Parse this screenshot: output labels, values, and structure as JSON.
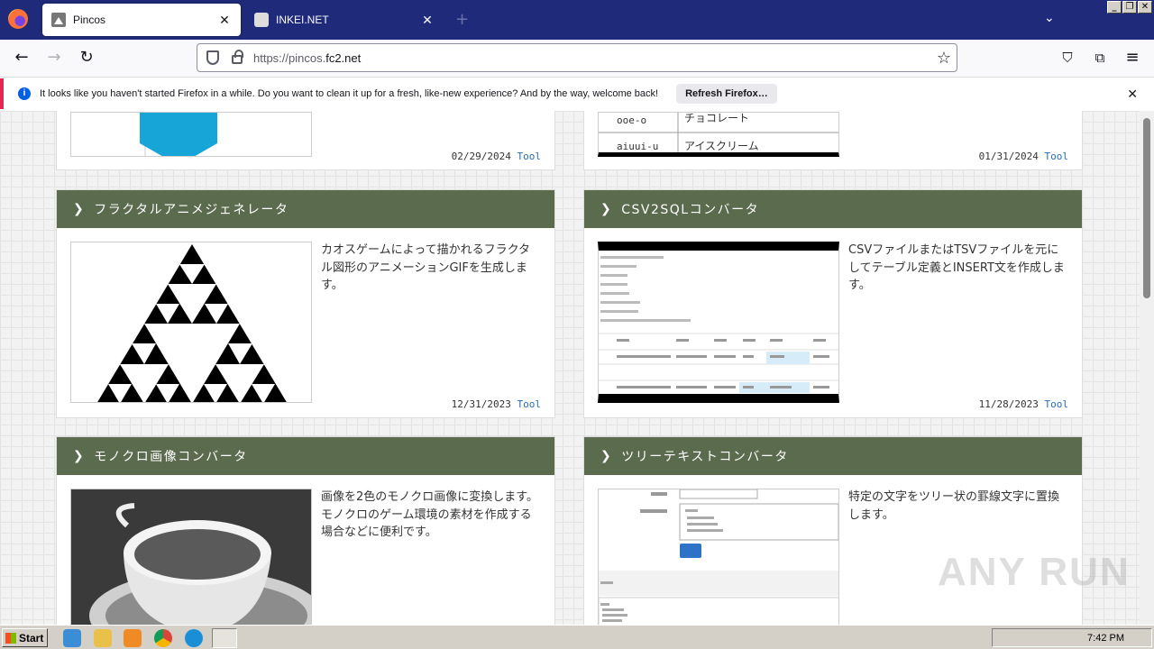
{
  "browser": {
    "tabs": [
      {
        "title": "Pincos",
        "active": true
      },
      {
        "title": "INKEI.NET",
        "active": false
      }
    ],
    "url_prefix": "https://pincos.",
    "url_domain": "fc2.net"
  },
  "notification": {
    "message": "It looks like you haven't started Firefox in a while. Do you want to clean it up for a fresh, like-new experience? And by the way, welcome back!",
    "button": "Refresh Firefox…"
  },
  "cards_top": [
    {
      "date": "02/29/2024",
      "link": "Tool"
    },
    {
      "date": "01/31/2024",
      "link": "Tool",
      "table_rows": [
        [
          "ooe-o",
          "チョコレート"
        ],
        [
          "aiuui-u",
          "アイスクリーム"
        ]
      ]
    }
  ],
  "cards": [
    {
      "title": "フラクタルアニメジェネレータ",
      "desc": "カオスゲームによって描かれるフラクタル図形のアニメーションGIFを生成します。",
      "date": "12/31/2023",
      "link": "Tool"
    },
    {
      "title": "CSV2SQLコンバータ",
      "desc": "CSVファイルまたはTSVファイルを元にしてテーブル定義とINSERT文を作成します。",
      "date": "11/28/2023",
      "link": "Tool"
    },
    {
      "title": "モノクロ画像コンバータ",
      "desc": "画像を2色のモノクロ画像に変換します。\nモノクロのゲーム環境の素材を作成する場合などに便利です。",
      "date": "",
      "link": ""
    },
    {
      "title": "ツリーテキストコンバータ",
      "desc": "特定の文字をツリー状の罫線文字に置換します。",
      "date": "",
      "link": ""
    }
  ],
  "taskbar": {
    "start": "Start",
    "clock": "7:42 PM"
  },
  "watermark": "ANY RUN"
}
